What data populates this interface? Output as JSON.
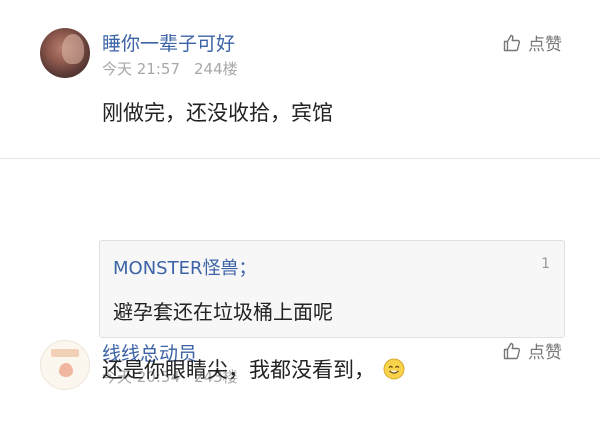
{
  "comments": [
    {
      "username": "睡你一辈子可好",
      "time": "今天 21:57",
      "floor": "244楼",
      "like_label": "点赞",
      "content": "刚做完，还没收拾，宾馆"
    },
    {
      "username": "线线总动员",
      "time": "今天 20:54",
      "floor": "243楼",
      "like_label": "点赞",
      "quote": {
        "author": "MONSTER怪兽；",
        "floor": "1",
        "text": "避孕套还在垃圾桶上面呢"
      },
      "content": "还是你眼睛尖，我都没看到，",
      "emoji_icon": "smile-emoji-icon"
    }
  ],
  "colors": {
    "username": "#3c63a6",
    "meta": "#a8a8a8",
    "quote_bg": "#f7f7f7"
  }
}
